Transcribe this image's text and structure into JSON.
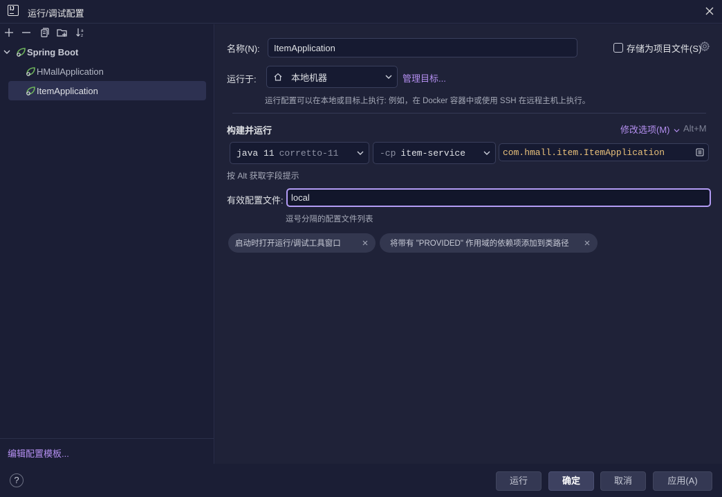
{
  "window": {
    "title": "运行/调试配置"
  },
  "sidebar": {
    "toolbar": [
      "add-icon",
      "remove-icon",
      "copy-icon",
      "new-folder-icon",
      "sort-icon"
    ],
    "group": {
      "label": "Spring Boot"
    },
    "items": [
      {
        "label": "HMallApplication",
        "selected": false
      },
      {
        "label": "ItemApplication",
        "selected": true
      }
    ],
    "edit_templates": "编辑配置模板..."
  },
  "form": {
    "name_label": "名称(N):",
    "name_value": "ItemApplication",
    "store_label": "存储为项目文件(S)",
    "run_on_label": "运行于:",
    "run_on_value": "本地机器",
    "manage_targets": "管理目标...",
    "run_on_hint": "运行配置可以在本地或目标上执行: 例如，在 Docker 容器中或使用 SSH 在远程主机上执行。",
    "build_section": "构建并运行",
    "modify_options": "修改选项(M)",
    "modify_shortcut": "Alt+M",
    "jdk_version": "java 11",
    "jdk_name": "corretto-11",
    "cp_prefix": "-cp",
    "cp_value": "item-service",
    "main_class": "com.hmall.item.ItemApplication",
    "alt_hint": "按 Alt 获取字段提示",
    "profiles_label": "有效配置文件:",
    "profiles_value": "local",
    "profiles_hint": "逗号分隔的配置文件列表",
    "chips": [
      "启动时打开运行/调试工具窗口",
      "将带有 \"PROVIDED\" 作用域的依赖项添加到类路径"
    ]
  },
  "footer": {
    "help": "?",
    "run": "运行",
    "ok": "确定",
    "cancel": "取消",
    "apply": "应用(A)"
  },
  "colors": {
    "accent_link": "#b48ff0",
    "focus_border": "#b39cf5",
    "main_class": "#e8c07a",
    "spring_green": "#6db35b"
  }
}
